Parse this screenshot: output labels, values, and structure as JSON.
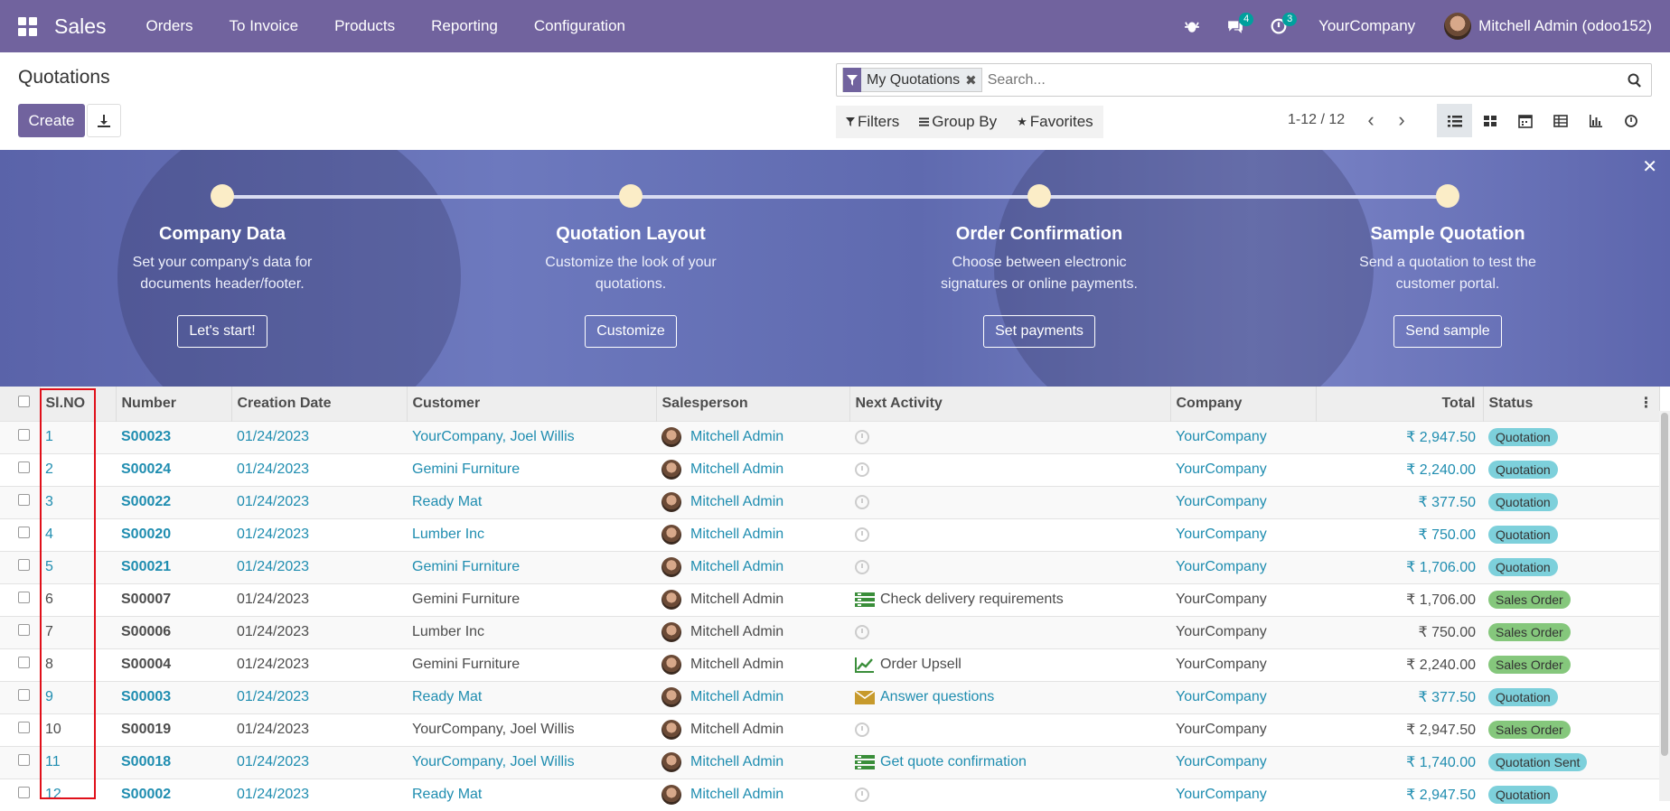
{
  "navbar": {
    "brand": "Sales",
    "menus": [
      "Orders",
      "To Invoice",
      "Products",
      "Reporting",
      "Configuration"
    ],
    "chat_count": "4",
    "activity_count": "3",
    "company": "YourCompany",
    "user": "Mitchell Admin (odoo152)"
  },
  "control_panel": {
    "title": "Quotations",
    "create_label": "Create",
    "facet_label": "My Quotations",
    "search_placeholder": "Search...",
    "filters_label": "Filters",
    "groupby_label": "Group By",
    "favorites_label": "Favorites",
    "pager": "1-12 / 12"
  },
  "banner": {
    "steps": [
      {
        "title": "Company Data",
        "desc": "Set your company's data for documents header/footer.",
        "button": "Let's start!"
      },
      {
        "title": "Quotation Layout",
        "desc": "Customize the look of your quotations.",
        "button": "Customize"
      },
      {
        "title": "Order Confirmation",
        "desc": "Choose between electronic signatures or online payments.",
        "button": "Set payments"
      },
      {
        "title": "Sample Quotation",
        "desc": "Send a quotation to test the customer portal.",
        "button": "Send sample"
      }
    ]
  },
  "table": {
    "headers": [
      "Sl.NO",
      "Number",
      "Creation Date",
      "Customer",
      "Salesperson",
      "Next Activity",
      "Company",
      "Total",
      "Status"
    ],
    "rows": [
      {
        "sl": "1",
        "number": "S00023",
        "date": "01/24/2023",
        "customer": "YourCompany, Joel Willis",
        "salesperson": "Mitchell Admin",
        "activity": "",
        "company": "YourCompany",
        "total": "₹ 2,947.50",
        "status": "Quotation"
      },
      {
        "sl": "2",
        "number": "S00024",
        "date": "01/24/2023",
        "customer": "Gemini Furniture",
        "salesperson": "Mitchell Admin",
        "activity": "",
        "company": "YourCompany",
        "total": "₹ 2,240.00",
        "status": "Quotation"
      },
      {
        "sl": "3",
        "number": "S00022",
        "date": "01/24/2023",
        "customer": "Ready Mat",
        "salesperson": "Mitchell Admin",
        "activity": "",
        "company": "YourCompany",
        "total": "₹ 377.50",
        "status": "Quotation"
      },
      {
        "sl": "4",
        "number": "S00020",
        "date": "01/24/2023",
        "customer": "Lumber Inc",
        "salesperson": "Mitchell Admin",
        "activity": "",
        "company": "YourCompany",
        "total": "₹ 750.00",
        "status": "Quotation"
      },
      {
        "sl": "5",
        "number": "S00021",
        "date": "01/24/2023",
        "customer": "Gemini Furniture",
        "salesperson": "Mitchell Admin",
        "activity": "",
        "company": "YourCompany",
        "total": "₹ 1,706.00",
        "status": "Quotation"
      },
      {
        "sl": "6",
        "number": "S00007",
        "date": "01/24/2023",
        "customer": "Gemini Furniture",
        "salesperson": "Mitchell Admin",
        "activity": "Check delivery requirements",
        "company": "YourCompany",
        "total": "₹ 1,706.00",
        "status": "Sales Order"
      },
      {
        "sl": "7",
        "number": "S00006",
        "date": "01/24/2023",
        "customer": "Lumber Inc",
        "salesperson": "Mitchell Admin",
        "activity": "",
        "company": "YourCompany",
        "total": "₹ 750.00",
        "status": "Sales Order"
      },
      {
        "sl": "8",
        "number": "S00004",
        "date": "01/24/2023",
        "customer": "Gemini Furniture",
        "salesperson": "Mitchell Admin",
        "activity": "Order Upsell",
        "company": "YourCompany",
        "total": "₹ 2,240.00",
        "status": "Sales Order"
      },
      {
        "sl": "9",
        "number": "S00003",
        "date": "01/24/2023",
        "customer": "Ready Mat",
        "salesperson": "Mitchell Admin",
        "activity": "Answer questions",
        "company": "YourCompany",
        "total": "₹ 377.50",
        "status": "Quotation"
      },
      {
        "sl": "10",
        "number": "S00019",
        "date": "01/24/2023",
        "customer": "YourCompany, Joel Willis",
        "salesperson": "Mitchell Admin",
        "activity": "",
        "company": "YourCompany",
        "total": "₹ 2,947.50",
        "status": "Sales Order"
      },
      {
        "sl": "11",
        "number": "S00018",
        "date": "01/24/2023",
        "customer": "YourCompany, Joel Willis",
        "salesperson": "Mitchell Admin",
        "activity": "Get quote confirmation",
        "company": "YourCompany",
        "total": "₹ 1,740.00",
        "status": "Quotation Sent"
      },
      {
        "sl": "12",
        "number": "S00002",
        "date": "01/24/2023",
        "customer": "Ready Mat",
        "salesperson": "Mitchell Admin",
        "activity": "",
        "company": "YourCompany",
        "total": "₹ 2,947.50",
        "status": "Quotation"
      }
    ]
  },
  "colors": {
    "brand": "#71639e",
    "link": "#1f8db0",
    "quotation_badge": "#7dd0db",
    "sales_order_badge": "#85c77c",
    "highlight": "#e0101a"
  },
  "icons": {
    "apps": "grid-icon",
    "debug": "bug-icon",
    "chat": "chat-icon",
    "activity": "clock-icon",
    "download": "download-icon",
    "search": "search-icon"
  }
}
